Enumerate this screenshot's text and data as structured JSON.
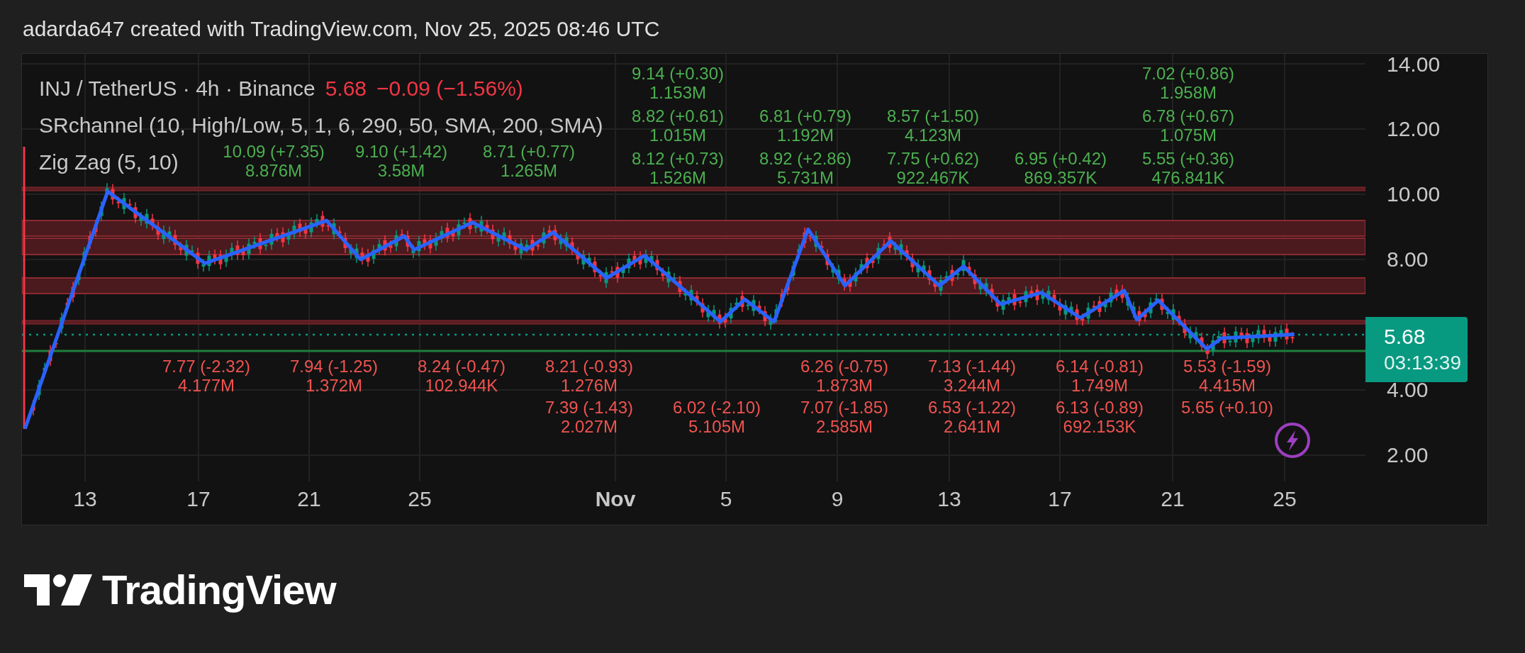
{
  "header": {
    "text": "adarda647 created with TradingView.com, Nov 25, 2025 08:46 UTC"
  },
  "legend": {
    "symbol": "INJ / TetherUS · 4h · Binance",
    "price": "5.68",
    "change": "−0.09 (−1.56%)",
    "indicators": [
      "SRchannel (10, High/Low, 5, 1, 6, 290, 50, SMA, 200, SMA)",
      "Zig Zag (5, 10)"
    ]
  },
  "zigzag_labels": [
    {
      "kind": "high",
      "change": "10.09 (+7.35)",
      "volume": "8.876M"
    },
    {
      "kind": "high",
      "change": "9.10 (+1.42)",
      "volume": "3.58M"
    },
    {
      "kind": "high",
      "change": "8.71 (+0.77)",
      "volume": "1.265M"
    },
    {
      "kind": "high",
      "change": "9.14 (+0.30)",
      "volume": "1.153M"
    },
    {
      "kind": "high",
      "change": "8.82 (+0.61)",
      "volume": "1.015M"
    },
    {
      "kind": "high",
      "change": "8.12 (+0.73)",
      "volume": "1.526M"
    },
    {
      "kind": "high",
      "change": "6.81 (+0.79)",
      "volume": "1.192M"
    },
    {
      "kind": "high",
      "change": "8.92 (+2.86)",
      "volume": "5.731M"
    },
    {
      "kind": "high",
      "change": "8.57 (+1.50)",
      "volume": "4.123M"
    },
    {
      "kind": "high",
      "change": "7.75 (+0.62)",
      "volume": "922.467K"
    },
    {
      "kind": "high",
      "change": "6.95 (+0.42)",
      "volume": "869.357K"
    },
    {
      "kind": "high",
      "change": "7.02 (+0.86)",
      "volume": "1.958M"
    },
    {
      "kind": "high",
      "change": "6.78 (+0.67)",
      "volume": "1.075M"
    },
    {
      "kind": "high",
      "change": "5.55 (+0.36)",
      "volume": "476.841K"
    },
    {
      "kind": "low",
      "change": "7.77 (-2.32)",
      "volume": "4.177M"
    },
    {
      "kind": "low",
      "change": "7.94 (-1.25)",
      "volume": "1.372M"
    },
    {
      "kind": "low",
      "change": "8.24 (-0.47)",
      "volume": "102.944K"
    },
    {
      "kind": "low",
      "change": "8.21 (-0.93)",
      "volume": "1.276M"
    },
    {
      "kind": "low",
      "change": "7.39 (-1.43)",
      "volume": "2.027M"
    },
    {
      "kind": "low",
      "change": "6.02 (-2.10)",
      "volume": "5.105M"
    },
    {
      "kind": "low",
      "change": "6.26 (-0.75)",
      "volume": "1.873M"
    },
    {
      "kind": "low",
      "change": "7.07 (-1.85)",
      "volume": "2.585M"
    },
    {
      "kind": "low",
      "change": "7.13 (-1.44)",
      "volume": "3.244M"
    },
    {
      "kind": "low",
      "change": "6.53 (-1.22)",
      "volume": "2.641M"
    },
    {
      "kind": "low",
      "change": "6.14 (-0.81)",
      "volume": "1.749M"
    },
    {
      "kind": "low",
      "change": "6.13 (-0.89)",
      "volume": "692.153K"
    },
    {
      "kind": "low",
      "change": "5.53 (-1.59)",
      "volume": "4.415M"
    },
    {
      "kind": "low",
      "change": "5.65 (+0.10)"
    }
  ],
  "price_axis": {
    "ticks": [
      "14.00",
      "12.00",
      "10.00",
      "8.00",
      "4.00",
      "2.00"
    ]
  },
  "last_price": {
    "price": "5.68",
    "countdown": "03:13:39"
  },
  "time_axis": {
    "labels": [
      {
        "text": "13",
        "bold": false
      },
      {
        "text": "17",
        "bold": false
      },
      {
        "text": "21",
        "bold": false
      },
      {
        "text": "25",
        "bold": false
      },
      {
        "text": "Nov",
        "bold": true
      },
      {
        "text": "5",
        "bold": false
      },
      {
        "text": "9",
        "bold": false
      },
      {
        "text": "13",
        "bold": false
      },
      {
        "text": "17",
        "bold": false
      },
      {
        "text": "21",
        "bold": false
      },
      {
        "text": "25",
        "bold": false
      }
    ]
  },
  "brand": "TradingView"
}
